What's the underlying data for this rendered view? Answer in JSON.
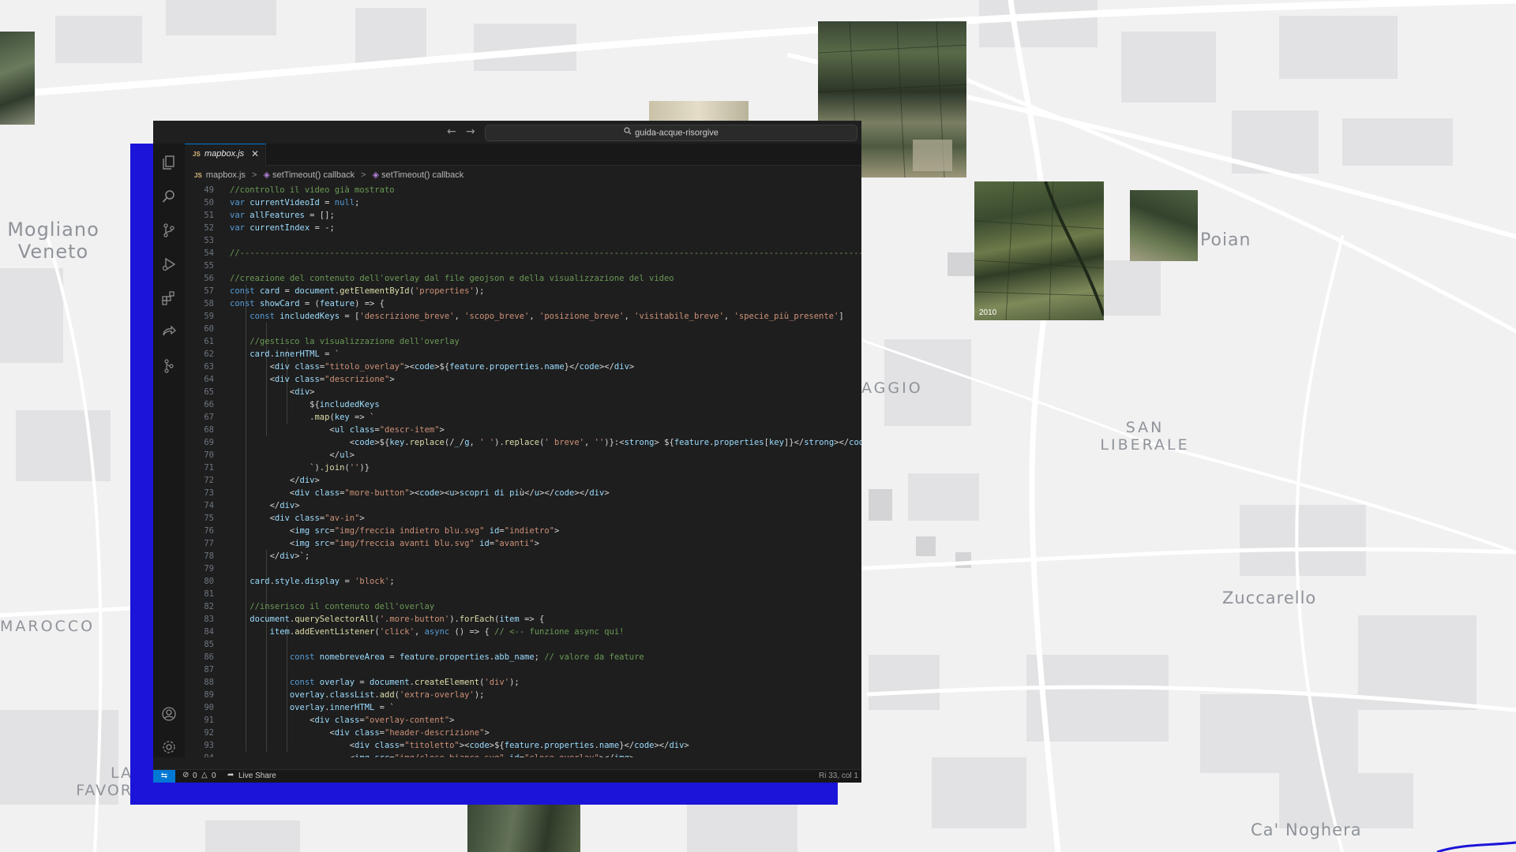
{
  "map": {
    "labels": [
      "Mogliano\nVeneto",
      "Poian",
      "AGGIO",
      "SAN\nLIBERALE",
      "Zuccarello",
      "MAROCCO",
      "LA\nFAVOR",
      "Ca' Noghera"
    ],
    "photo_year": "2010"
  },
  "editor": {
    "titlebar": {
      "back_icon": "arrow-left-icon",
      "forward_icon": "arrow-right-icon",
      "search_icon": "search-icon",
      "search_text": "guida-acque-risorgive"
    },
    "activity_bar": [
      "files-icon",
      "search-icon",
      "source-control-icon",
      "run-debug-icon",
      "extensions-icon",
      "live-share-icon",
      "git-graph-icon",
      "account-icon",
      "settings-gear-icon"
    ],
    "tab": {
      "lang_badge": "JS",
      "label": "mapbox.js",
      "close_icon": "close-icon"
    },
    "breadcrumb": {
      "file_badge": "JS",
      "file": "mapbox.js",
      "sep": ">",
      "item1": "setTimeout() callback",
      "item2": "setTimeout() callback"
    },
    "code_lines": [
      {
        "n": "49",
        "t": "//controllo il video già mostrato"
      },
      {
        "n": "50",
        "t": "var currentVideoId = null;"
      },
      {
        "n": "51",
        "t": "var allFeatures = [];"
      },
      {
        "n": "52",
        "t": "var currentIndex = -1;"
      },
      {
        "n": "53",
        "t": ""
      },
      {
        "n": "54",
        "t": "//---------------------------------------------------------------------------------------------------------------------------------------"
      },
      {
        "n": "55",
        "t": ""
      },
      {
        "n": "56",
        "t": "//creazione del contenuto dell'overlay dal file geojson e della visualizzazione del video"
      },
      {
        "n": "57",
        "t": "const card = document.getElementById('properties');"
      },
      {
        "n": "58",
        "t": "const showCard = (feature) => {"
      },
      {
        "n": "59",
        "t": "    const includedKeys = ['descrizione_breve', 'scopo_breve', 'posizione_breve', 'visitabile_breve', 'specie_più_presente']"
      },
      {
        "n": "60",
        "t": ""
      },
      {
        "n": "61",
        "t": "    //gestisco la visualizzazione dell'overlay"
      },
      {
        "n": "62",
        "t": "    card.innerHTML = `"
      },
      {
        "n": "63",
        "t": "        <div class=\"titolo_overlay\"><code>${feature.properties.name}</code></div>"
      },
      {
        "n": "64",
        "t": "        <div class=\"descrizione\">"
      },
      {
        "n": "65",
        "t": "            <div>"
      },
      {
        "n": "66",
        "t": "                ${includedKeys"
      },
      {
        "n": "67",
        "t": "                .map(key => `"
      },
      {
        "n": "68",
        "t": "                    <ul class=\"descr-item\">"
      },
      {
        "n": "69",
        "t": "                        <code>${key.replace(/_/g, ' ').replace(' breve', '')}:<strong> ${feature.properties[key]}</strong></code>"
      },
      {
        "n": "70",
        "t": "                    </ul>"
      },
      {
        "n": "71",
        "t": "                `).join('')}"
      },
      {
        "n": "72",
        "t": "            </div>"
      },
      {
        "n": "73",
        "t": "            <div class=\"more-button\"><code><u>scopri di più</u></code></div>"
      },
      {
        "n": "74",
        "t": "        </div>"
      },
      {
        "n": "75",
        "t": "        <div class=\"av-in\">"
      },
      {
        "n": "76",
        "t": "            <img src=\"img/freccia indietro blu.svg\" id=\"indietro\">"
      },
      {
        "n": "77",
        "t": "            <img src=\"img/freccia avanti blu.svg\" id=\"avanti\">"
      },
      {
        "n": "78",
        "t": "        </div>`;"
      },
      {
        "n": "79",
        "t": ""
      },
      {
        "n": "80",
        "t": "    card.style.display = 'block';"
      },
      {
        "n": "81",
        "t": ""
      },
      {
        "n": "82",
        "t": "    //inserisco il contenuto dell'overlay"
      },
      {
        "n": "83",
        "t": "    document.querySelectorAll('.more-button').forEach(item => {"
      },
      {
        "n": "84",
        "t": "        item.addEventListener('click', async () => { // <-- funzione async qui!"
      },
      {
        "n": "85",
        "t": ""
      },
      {
        "n": "86",
        "t": "            const nomebreveArea = feature.properties.abb_name; // valore da feature"
      },
      {
        "n": "87",
        "t": ""
      },
      {
        "n": "88",
        "t": "            const overlay = document.createElement('div');"
      },
      {
        "n": "89",
        "t": "            overlay.classList.add('extra-overlay');"
      },
      {
        "n": "90",
        "t": "            overlay.innerHTML = `"
      },
      {
        "n": "91",
        "t": "                <div class=\"overlay-content\">"
      },
      {
        "n": "92",
        "t": "                    <div class=\"header-descrizione\">"
      },
      {
        "n": "93",
        "t": "                        <div class=\"titoletto\"><code>${feature.properties.name}</code></div>"
      },
      {
        "n": "94",
        "t": "                        <img src=\"img/close_bianco.svg\" id=\"close-overlay\"></img>"
      }
    ],
    "status_bar": {
      "remote_icon": "remote-icon",
      "errors": "0",
      "warnings": "0",
      "live_share": "Live Share",
      "position": "Ri 33, col 1"
    },
    "colors": {
      "editor_bg": "#1e1e1e",
      "accent_blue": "#1c14d8",
      "status_remote": "#0078d4",
      "comment": "#6a9955",
      "keyword": "#569cd6",
      "string": "#ce9178",
      "function": "#dcdcaa",
      "variable": "#9cdcfe"
    }
  }
}
